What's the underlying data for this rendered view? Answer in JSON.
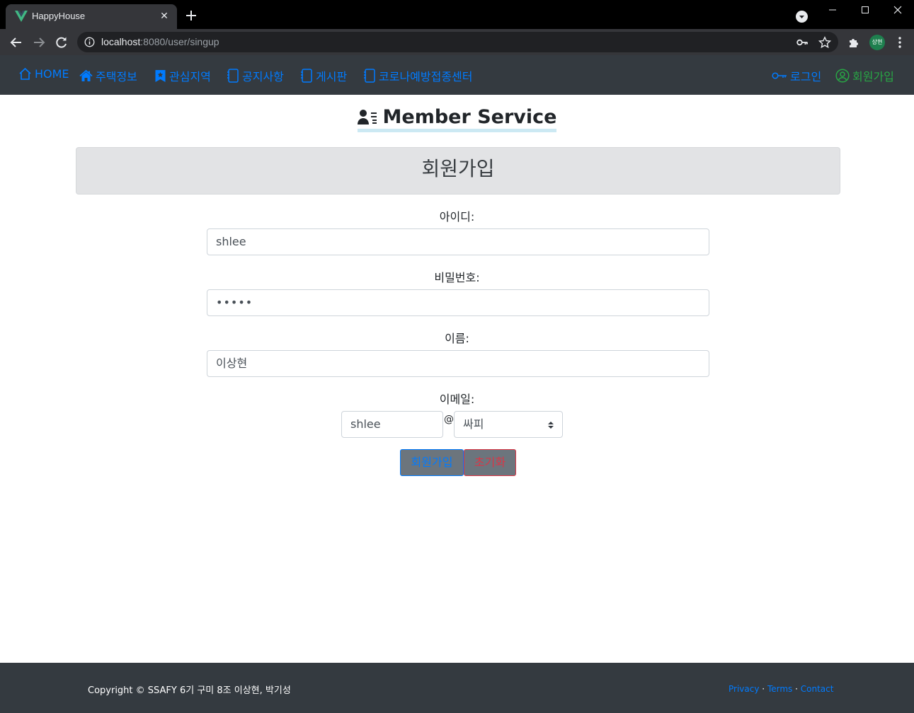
{
  "browser": {
    "tab_title": "HappyHouse",
    "url_host": "localhost",
    "url_rest": ":8080/user/singup",
    "profile_initials": "상현"
  },
  "navbar": {
    "left": [
      {
        "label": "HOME",
        "icon": "home-icon"
      },
      {
        "label": "주택정보",
        "icon": "house-fill-icon"
      },
      {
        "label": "관심지역",
        "icon": "bookmark-star-icon"
      },
      {
        "label": "공지사항",
        "icon": "journal-icon"
      },
      {
        "label": "게시판",
        "icon": "journal-icon"
      },
      {
        "label": "코로나예방접종센터",
        "icon": "journal-icon"
      }
    ],
    "right": [
      {
        "label": "로그인",
        "icon": "key-icon"
      },
      {
        "label": "회원가입",
        "icon": "person-circle-icon"
      }
    ],
    "colors": {
      "link": "#007bff",
      "success": "#28a745",
      "bg": "#343a40"
    }
  },
  "page": {
    "title": "Member Service",
    "heading": "회원가입"
  },
  "form": {
    "id_label": "아이디:",
    "id_value": "shlee",
    "password_label": "비밀번호:",
    "password_value": "•••••",
    "name_label": "이름:",
    "name_value": "이상현",
    "email_label": "이메일:",
    "email_user": "shlee",
    "email_at": "@",
    "email_domain": "싸피",
    "submit_label": "회원가입",
    "reset_label": "초기화"
  },
  "footer": {
    "copyright": "Copyright © SSAFY 6기 구미 8조 이상현, 박기성",
    "links": [
      "Privacy",
      "Terms",
      "Contact"
    ],
    "separator": "·"
  }
}
